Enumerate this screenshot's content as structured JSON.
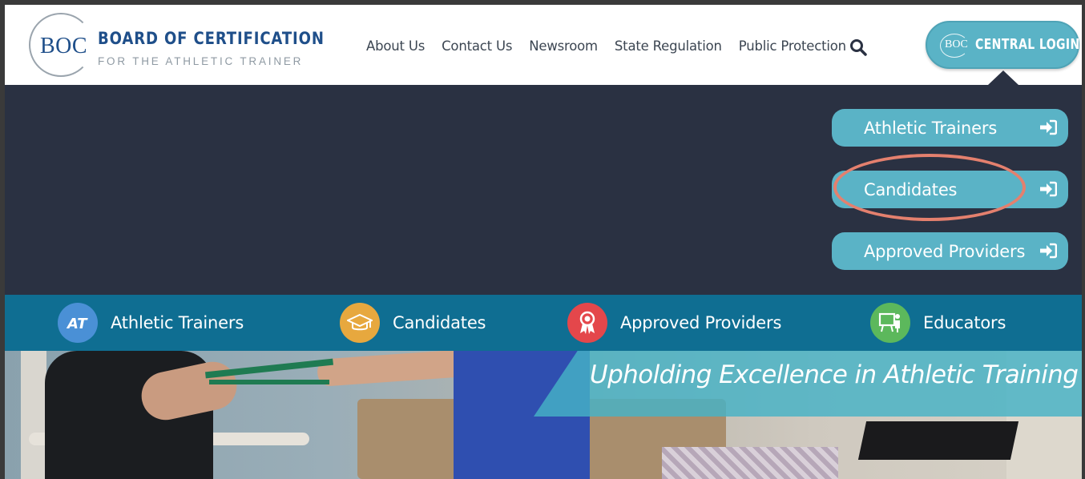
{
  "logo": {
    "abbr": "BOC",
    "title": "BOARD OF CERTIFICATION",
    "subtitle": "FOR THE ATHLETIC TRAINER"
  },
  "nav": {
    "items": [
      {
        "label": "About Us"
      },
      {
        "label": "Contact Us"
      },
      {
        "label": "Newsroom"
      },
      {
        "label": "State Regulation"
      },
      {
        "label": "Public Protection"
      }
    ],
    "search_icon": "search-icon"
  },
  "login": {
    "abbr": "BOC",
    "label": "CENTRAL LOGIN"
  },
  "dropdown": {
    "items": [
      {
        "label": "Athletic Trainers",
        "icon": "sign-in-icon"
      },
      {
        "label": "Candidates",
        "icon": "sign-in-icon",
        "highlighted": true
      },
      {
        "label": "Approved Providers",
        "icon": "sign-in-icon"
      }
    ],
    "highlight_color": "#e4806e"
  },
  "categories": [
    {
      "label": "Athletic Trainers",
      "icon": "at-icon",
      "icon_text": "AT",
      "color": "#4a90d6"
    },
    {
      "label": "Candidates",
      "icon": "graduation-cap-icon",
      "color": "#e7a83e"
    },
    {
      "label": "Approved Providers",
      "icon": "award-ribbon-icon",
      "color": "#e4474b"
    },
    {
      "label": "Educators",
      "icon": "teacher-board-icon",
      "color": "#5cb85c"
    }
  ],
  "hero": {
    "title": "Upholding Excellence in Athletic Training"
  },
  "colors": {
    "brand_blue": "#1f4f8a",
    "accent_teal": "#5ab3c6",
    "dark_band": "#2a3142",
    "category_bar": "#0f6e92"
  }
}
